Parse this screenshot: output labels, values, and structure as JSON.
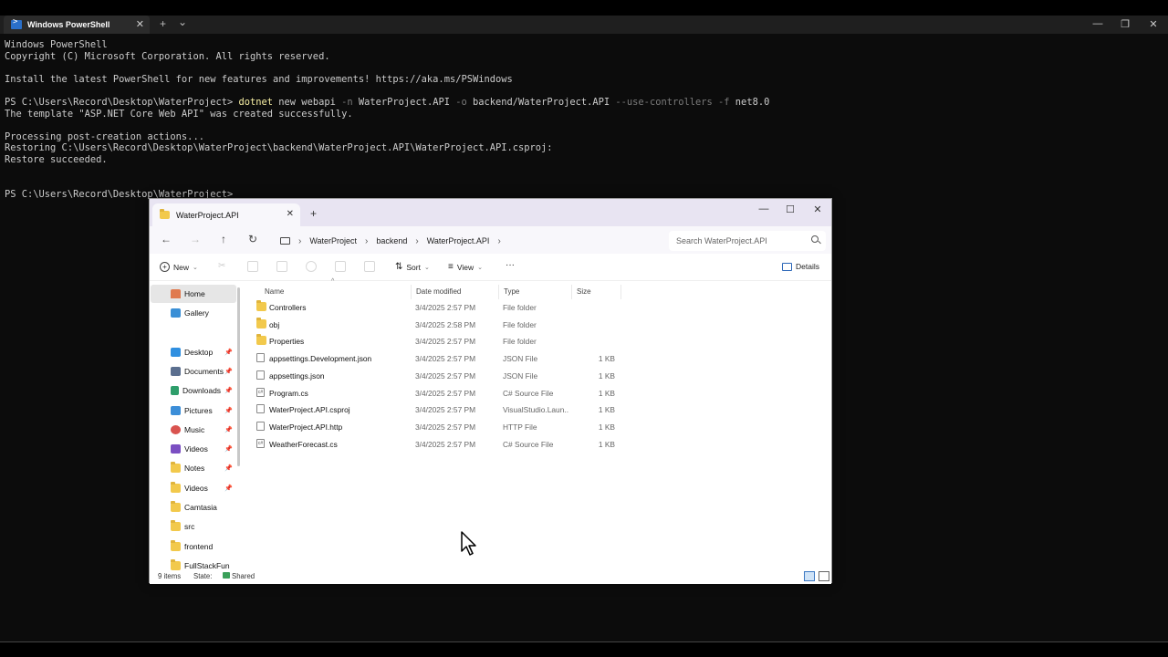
{
  "terminal": {
    "tab_title": "Windows PowerShell",
    "new_tab": "+",
    "dropdown": "⌄",
    "lines": {
      "l1": "Windows PowerShell",
      "l2": "Copyright (C) Microsoft Corporation. All rights reserved.",
      "l3": "Install the latest PowerShell for new features and improvements! https://aka.ms/PSWindows",
      "prompt1": "PS C:\\Users\\Record\\Desktop\\WaterProject> ",
      "cmd_word": "dotnet",
      "cmd_a": " new webapi ",
      "flag_n": "-n",
      "cmd_b": " WaterProject.API ",
      "flag_o": "-o",
      "cmd_c": " backend/WaterProject.API ",
      "flag_uc": "--use-controllers",
      "cmd_d": " ",
      "flag_f": "-f",
      "cmd_e": " net8.0",
      "l5": "The template \"ASP.NET Core Web API\" was created successfully.",
      "l6": "Processing post-creation actions...",
      "l7": "Restoring C:\\Users\\Record\\Desktop\\WaterProject\\backend\\WaterProject.API\\WaterProject.API.csproj:",
      "l8": "Restore succeeded.",
      "prompt2": "PS C:\\Users\\Record\\Desktop\\WaterProject>"
    }
  },
  "explorer": {
    "tab_title": "WaterProject.API",
    "breadcrumb": [
      "WaterProject",
      "backend",
      "WaterProject.API"
    ],
    "search_placeholder": "Search WaterProject.API",
    "toolbar": {
      "new": "New",
      "sort": "Sort",
      "view": "View",
      "more": "···",
      "details": "Details"
    },
    "nav": {
      "home": "Home",
      "gallery": "Gallery",
      "desktop": "Desktop",
      "documents": "Documents",
      "downloads": "Downloads",
      "pictures": "Pictures",
      "music": "Music",
      "videos": "Videos",
      "notes": "Notes",
      "videos2": "Videos",
      "camtasia": "Camtasia",
      "src": "src",
      "frontend": "frontend",
      "fullstack": "FullStackFun"
    },
    "columns": {
      "name": "Name",
      "date": "Date modified",
      "type": "Type",
      "size": "Size"
    },
    "files": [
      {
        "name": "Controllers",
        "date": "3/4/2025 2:57 PM",
        "type": "File folder",
        "size": ""
      },
      {
        "name": "obj",
        "date": "3/4/2025 2:58 PM",
        "type": "File folder",
        "size": ""
      },
      {
        "name": "Properties",
        "date": "3/4/2025 2:57 PM",
        "type": "File folder",
        "size": ""
      },
      {
        "name": "appsettings.Development.json",
        "date": "3/4/2025 2:57 PM",
        "type": "JSON File",
        "size": "1 KB"
      },
      {
        "name": "appsettings.json",
        "date": "3/4/2025 2:57 PM",
        "type": "JSON File",
        "size": "1 KB"
      },
      {
        "name": "Program.cs",
        "date": "3/4/2025 2:57 PM",
        "type": "C# Source File",
        "size": "1 KB"
      },
      {
        "name": "WaterProject.API.csproj",
        "date": "3/4/2025 2:57 PM",
        "type": "VisualStudio.Laun...",
        "size": "1 KB"
      },
      {
        "name": "WaterProject.API.http",
        "date": "3/4/2025 2:57 PM",
        "type": "HTTP File",
        "size": "1 KB"
      },
      {
        "name": "WeatherForecast.cs",
        "date": "3/4/2025 2:57 PM",
        "type": "C# Source File",
        "size": "1 KB"
      }
    ],
    "status": {
      "count": "9 items",
      "state_label": "State:",
      "state_value": "Shared"
    }
  }
}
